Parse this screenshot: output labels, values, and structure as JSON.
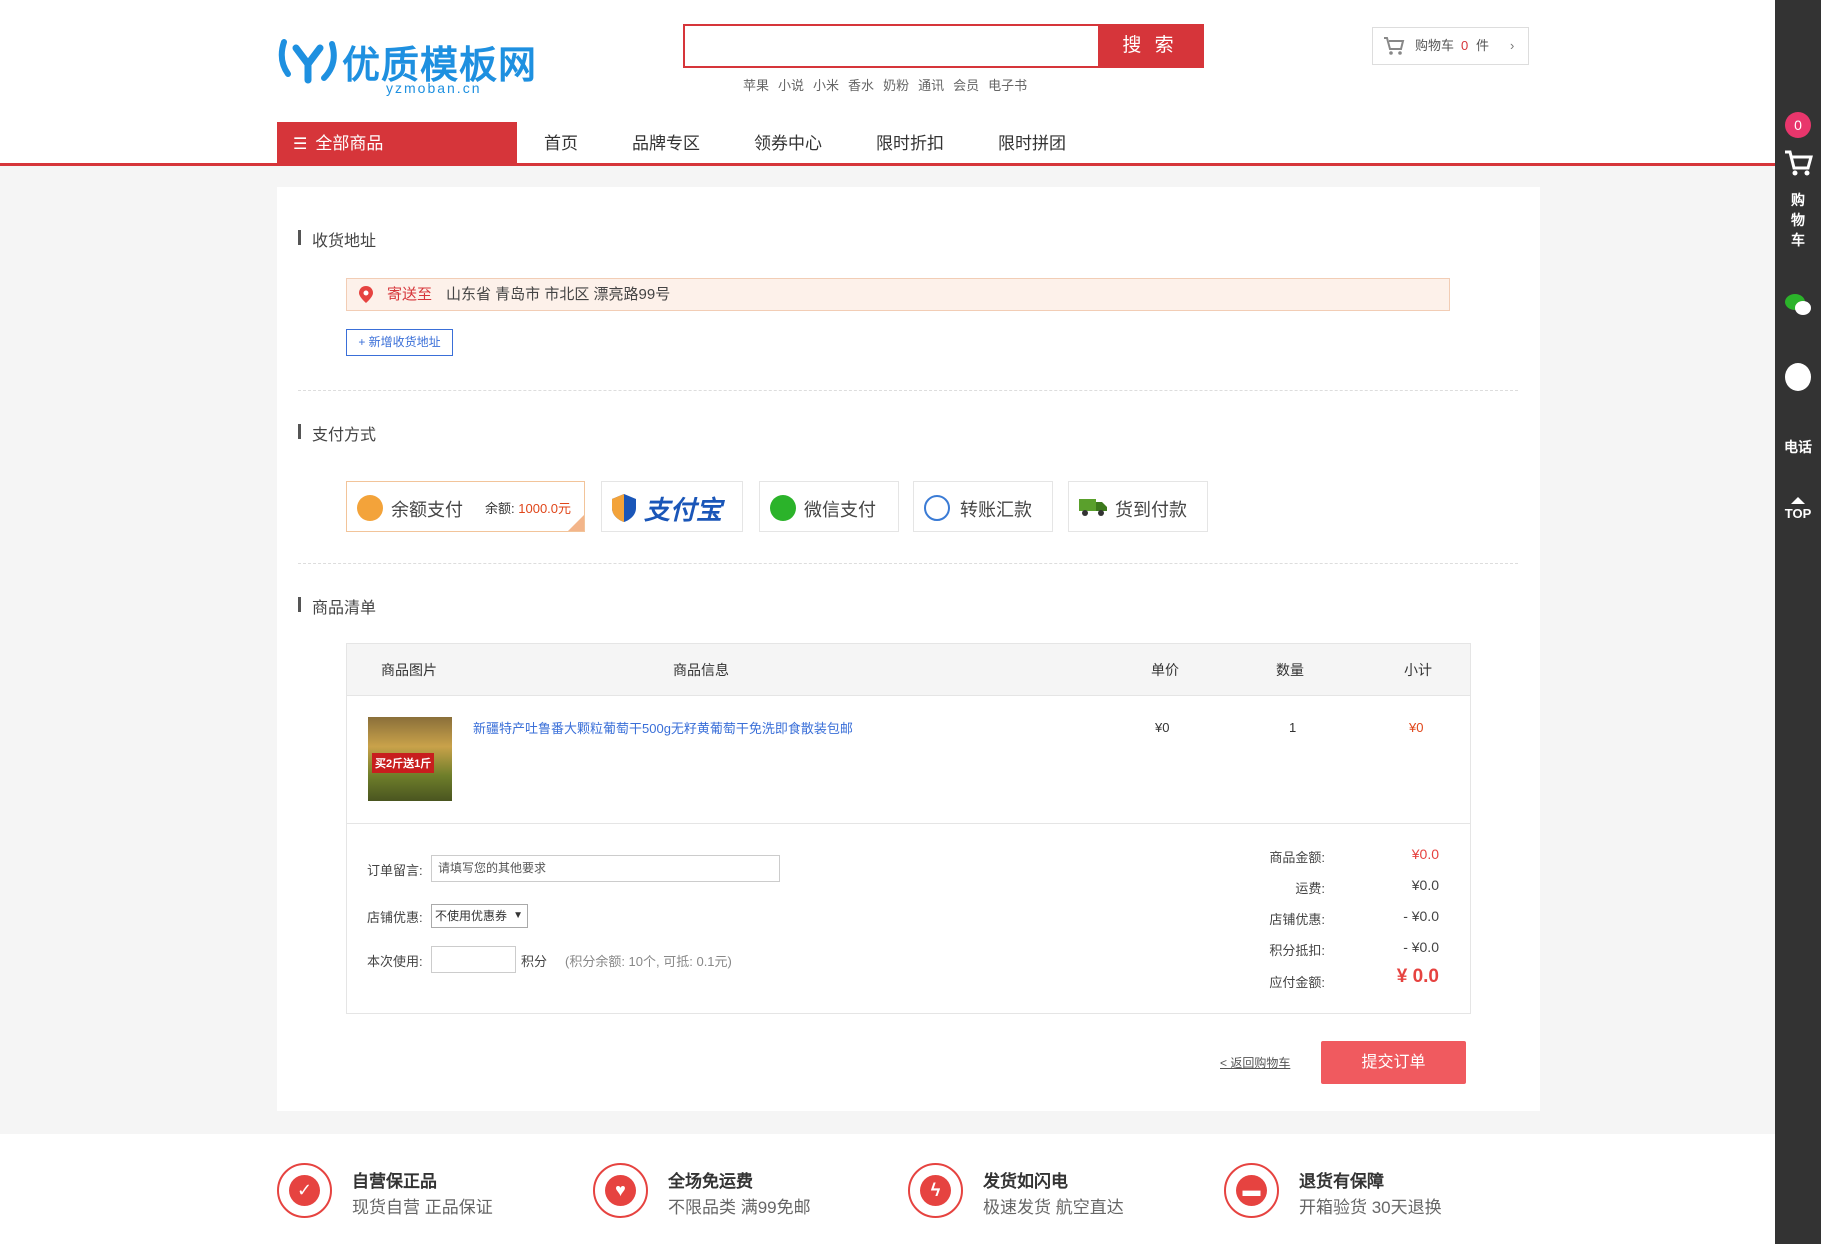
{
  "header": {
    "logo_text": "优质模板网",
    "logo_sub": "yzmoban.cn",
    "search_placeholder": "",
    "search_button": "搜 索",
    "hot_keywords": [
      "苹果",
      "小说",
      "小米",
      "香水",
      "奶粉",
      "通讯",
      "会员",
      "电子书"
    ],
    "cart_label": "购物车",
    "cart_count": "0",
    "cart_unit": "件",
    "cart_chevron": "›"
  },
  "nav": {
    "all_categories": "全部商品",
    "items": [
      "首页",
      "品牌专区",
      "领券中心",
      "限时折扣",
      "限时拼团"
    ]
  },
  "address": {
    "section_title": "收货地址",
    "ship_to_label": "寄送至",
    "address_text": "山东省 青岛市 市北区 漂亮路99号",
    "add_button": "+ 新增收货地址"
  },
  "payment": {
    "section_title": "支付方式",
    "methods": [
      {
        "label": "余额支付",
        "icon": "money-bag-icon"
      },
      {
        "label": "支付宝",
        "icon": "alipay-shield-icon"
      },
      {
        "label": "微信支付",
        "icon": "wechat-icon"
      },
      {
        "label": "转账汇款",
        "icon": "transfer-icon"
      },
      {
        "label": "货到付款",
        "icon": "truck-icon"
      }
    ],
    "balance_label": "余额:",
    "balance_value": "1000.0元"
  },
  "items": {
    "section_title": "商品清单",
    "columns": [
      "商品图片",
      "商品信息",
      "单价",
      "数量",
      "小计"
    ],
    "rows": [
      {
        "badge": "买2斤送1斤",
        "name": "新疆特产吐鲁番大颗粒葡萄干500g无籽黄葡萄干免洗即食散装包邮",
        "price": "¥0",
        "qty": "1",
        "subtotal": "¥0"
      }
    ]
  },
  "order": {
    "message_label": "订单留言:",
    "message_placeholder": "请填写您的其他要求",
    "coupon_label": "店铺优惠:",
    "coupon_selected": "不使用优惠券",
    "points_label": "本次使用:",
    "points_unit": "积分",
    "points_hint": "(积分余额: 10个, 可抵: 0.1元)",
    "summary": [
      {
        "label": "商品金额:",
        "value": "¥0.0"
      },
      {
        "label": "运费:",
        "value": "¥0.0"
      },
      {
        "label": "店铺优惠:",
        "value": "- ¥0.0"
      },
      {
        "label": "积分抵扣:",
        "value": "- ¥0.0"
      },
      {
        "label": "应付金额:",
        "value": "¥ 0.0"
      }
    ],
    "back_link": "< 返回购物车",
    "submit": "提交订单"
  },
  "services": [
    {
      "title": "自营保正品",
      "sub": "现货自营 正品保证"
    },
    {
      "title": "全场免运费",
      "sub": "不限品类 满99免邮"
    },
    {
      "title": "发货如闪电",
      "sub": "极速发货 航空直达"
    },
    {
      "title": "退货有保障",
      "sub": "开箱验货 30天退换"
    }
  ],
  "toolbar": {
    "cart_count": "0",
    "cart_label": "购物车",
    "tel_label": "电话",
    "top_label": "TOP"
  },
  "colors": {
    "accent": "#d6353a",
    "link": "#3a6fd8",
    "price": "#e64340"
  }
}
